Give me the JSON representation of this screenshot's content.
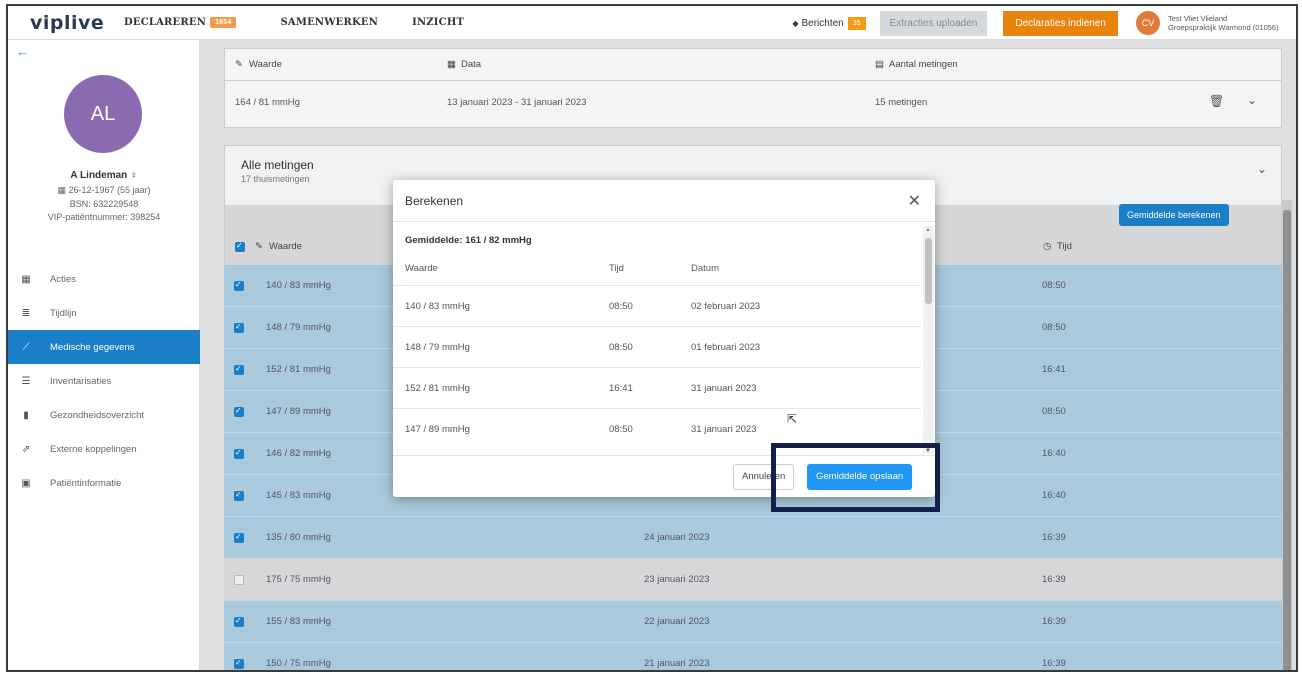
{
  "topbar": {
    "logo": "viplive",
    "nav": [
      {
        "label": "DECLAREREN",
        "badge": "1654"
      },
      {
        "label": "SAMENWERKEN"
      },
      {
        "label": "INZICHT"
      }
    ],
    "messages_label": "Berichten",
    "messages_count": "35",
    "extract_label": "Extracties uploaden",
    "declare_label": "Declaraties indienen",
    "user_initials": "CV",
    "user_name": "Test Vliet Vlieland",
    "user_practice": "Groepspraktijk Warmond (01056)"
  },
  "sidebar": {
    "avatar_initials": "AL",
    "patient_name": "A Lindeman ♀",
    "dob": "26-12-1967 (55 jaar)",
    "bsn": "BSN: 632229548",
    "vip_number": "VIP-patiëntnummer: 398254",
    "menu": [
      {
        "icon": "calendar-icon",
        "glyph": "▦",
        "label": "Acties"
      },
      {
        "icon": "list-icon",
        "glyph": "≣",
        "label": "Tijdlijn"
      },
      {
        "icon": "chart-icon",
        "glyph": "⟋",
        "label": "Medische gegevens",
        "active": true
      },
      {
        "icon": "list-icon",
        "glyph": "☰",
        "label": "Inventarisaties"
      },
      {
        "icon": "file-icon",
        "glyph": "▮",
        "label": "Gezondheidsoverzicht"
      },
      {
        "icon": "external-link-icon",
        "glyph": "⇗",
        "label": "Externe koppelingen"
      },
      {
        "icon": "id-card-icon",
        "glyph": "▣",
        "label": "Patiëntinformatie"
      }
    ]
  },
  "summary_card": {
    "col_value": "Waarde",
    "col_data": "Data",
    "col_count": "Aantal metingen",
    "value": "164 / 81 mmHg",
    "date_range": "13 januari 2023 - 31 januari 2023",
    "count": "15 metingen"
  },
  "all_measurements": {
    "title": "Alle metingen",
    "subtitle": "17 thuismetingen",
    "calc_button": "Gemiddelde berekenen",
    "col_value": "Waarde",
    "col_time": "Tijd",
    "rows": [
      {
        "value": "140 / 83 mmHg",
        "date": "",
        "time": "08:50",
        "checked": true
      },
      {
        "value": "148 / 79 mmHg",
        "date": "",
        "time": "08:50",
        "checked": true
      },
      {
        "value": "152 / 81 mmHg",
        "date": "",
        "time": "16:41",
        "checked": true
      },
      {
        "value": "147 / 89 mmHg",
        "date": "",
        "time": "08:50",
        "checked": true
      },
      {
        "value": "146 / 82 mmHg",
        "date": "",
        "time": "16:40",
        "checked": true
      },
      {
        "value": "145 / 83 mmHg",
        "date": "",
        "time": "16:40",
        "checked": true
      },
      {
        "value": "135 / 80 mmHg",
        "date": "24 januari 2023",
        "time": "16:39",
        "checked": true
      },
      {
        "value": "175 / 75 mmHg",
        "date": "23 januari 2023",
        "time": "16:39",
        "checked": false
      },
      {
        "value": "155 / 83 mmHg",
        "date": "22 januari 2023",
        "time": "16:39",
        "checked": true
      },
      {
        "value": "150 / 75 mmHg",
        "date": "21 januari 2023",
        "time": "16:39",
        "checked": true
      }
    ]
  },
  "modal": {
    "title": "Berekenen",
    "average": "Gemiddelde: 161 / 82 mmHg",
    "col_value": "Waarde",
    "col_time": "Tijd",
    "col_date": "Datum",
    "rows": [
      {
        "value": "140 / 83 mmHg",
        "time": "08:50",
        "date": "02 februari 2023"
      },
      {
        "value": "148 / 79 mmHg",
        "time": "08:50",
        "date": "01 februari 2023"
      },
      {
        "value": "152 / 81 mmHg",
        "time": "16:41",
        "date": "31 januari 2023"
      },
      {
        "value": "147 / 89 mmHg",
        "time": "08:50",
        "date": "31 januari 2023"
      }
    ],
    "cancel_label": "Annuleren",
    "save_label": "Gemiddelde opslaan"
  }
}
